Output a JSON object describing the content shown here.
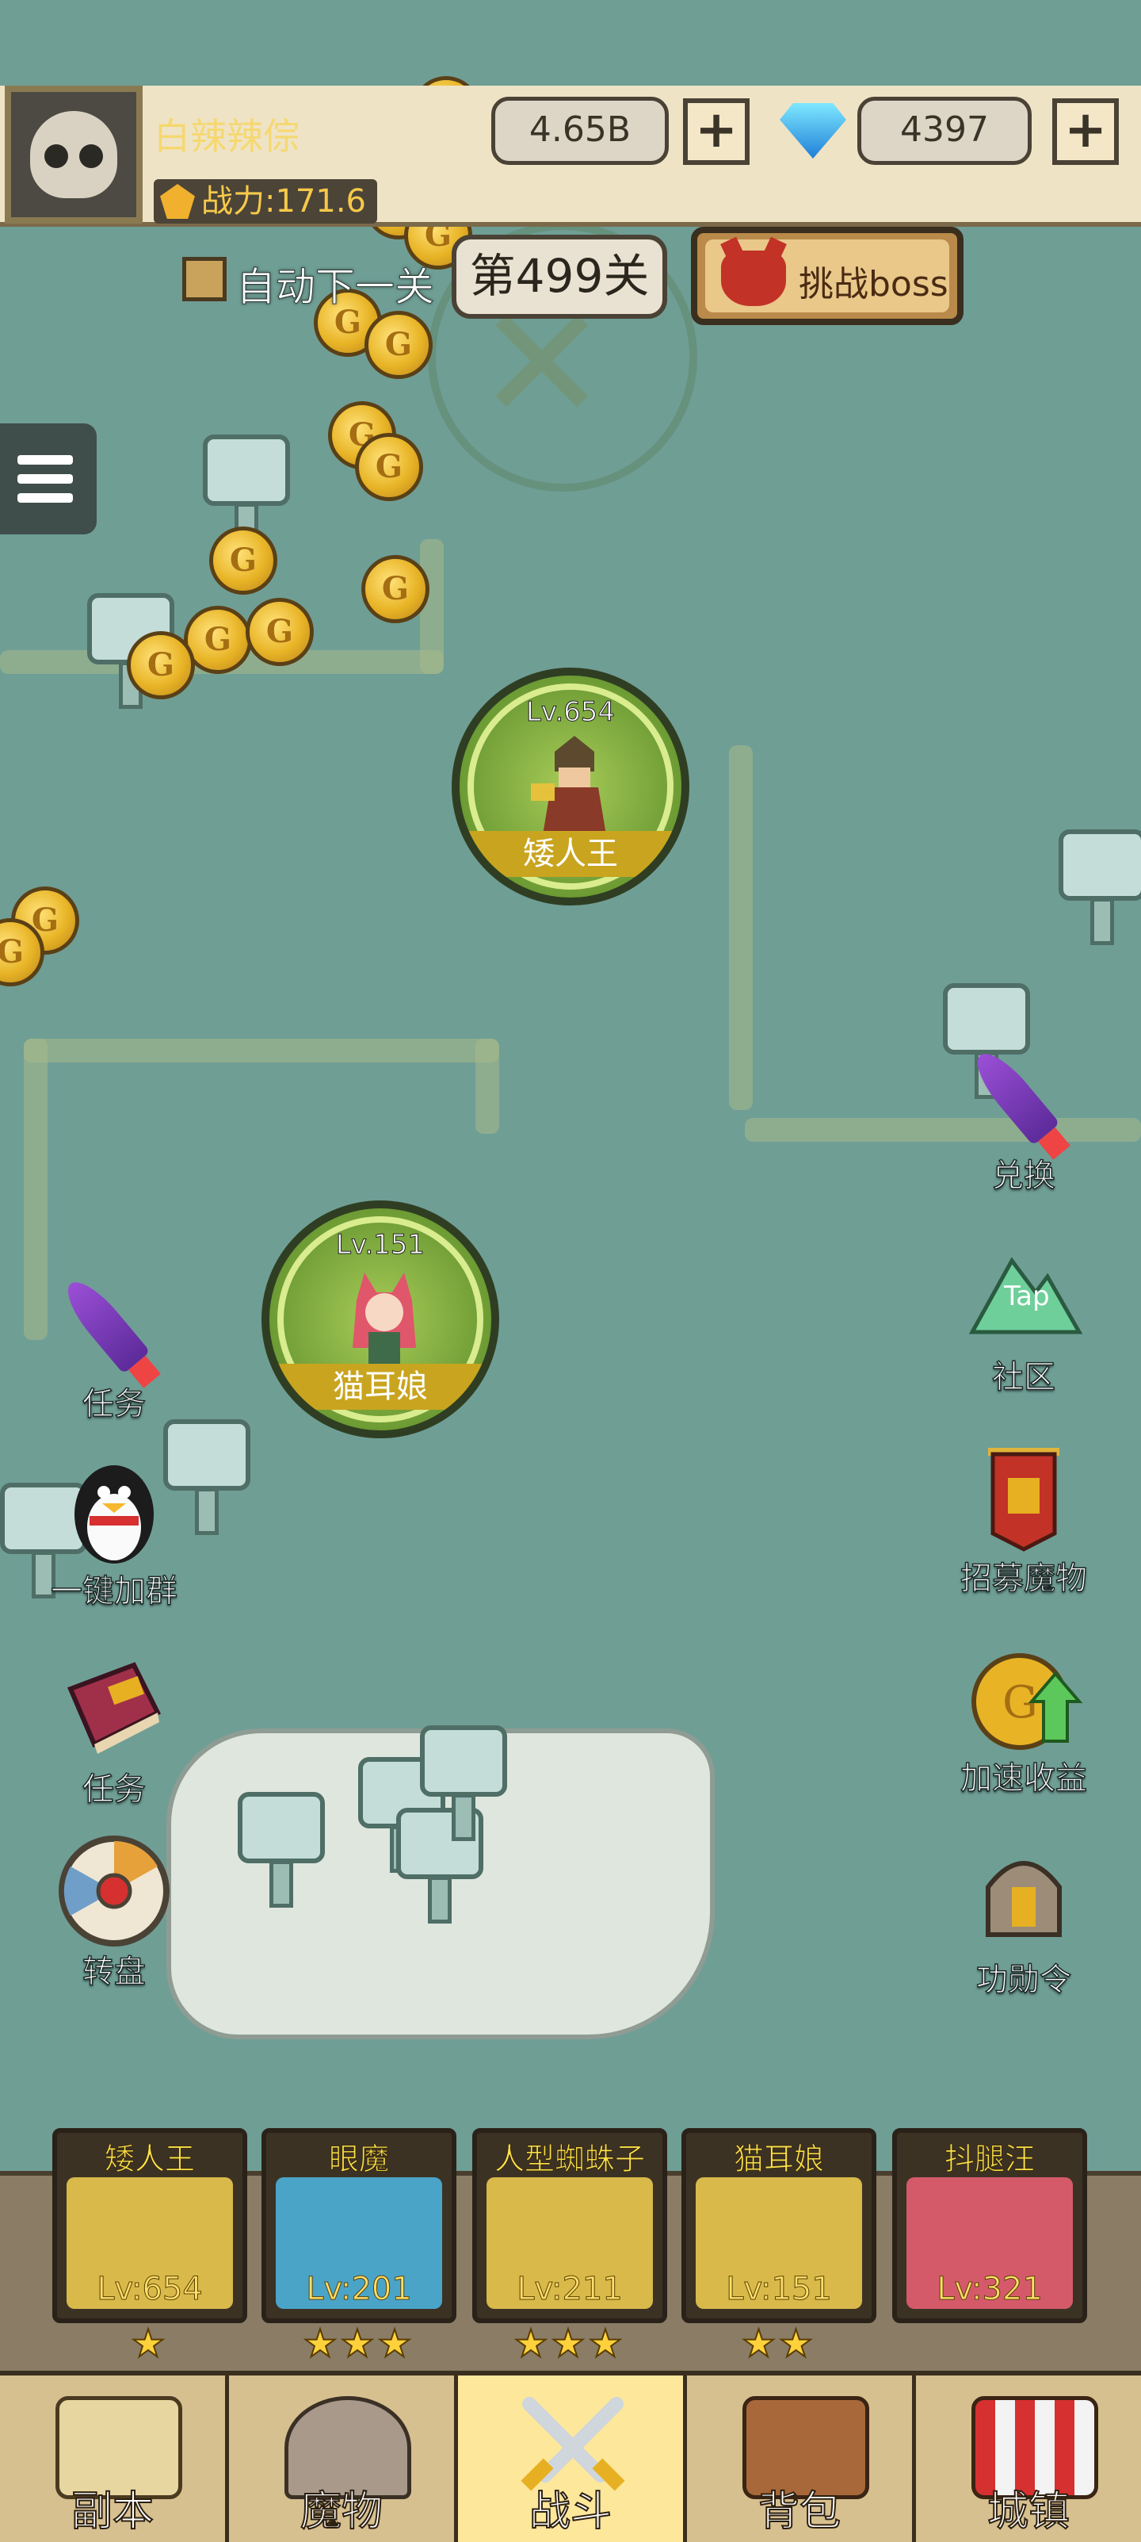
{
  "player": {
    "name": "白辣辣倧",
    "power": "战力:171.6"
  },
  "resources": {
    "gold": "4.65B",
    "gems": "4397"
  },
  "stage": {
    "auto_next_label": "自动下一关",
    "current_stage": "第499关",
    "challenge_boss_label": "挑战boss"
  },
  "map_heroes": [
    {
      "level": "Lv.654",
      "name": "矮人王"
    },
    {
      "level": "Lv.151",
      "name": "猫耳娘"
    }
  ],
  "left_buttons": [
    {
      "label": "任务",
      "icon": "rocket-icon"
    },
    {
      "label": "一键加群",
      "icon": "penguin-icon"
    },
    {
      "label": "任务",
      "icon": "book-icon"
    },
    {
      "label": "转盘",
      "icon": "wheel-icon"
    }
  ],
  "right_buttons": [
    {
      "label": "兑换",
      "icon": "rocket-icon"
    },
    {
      "label": "社区",
      "icon": "tap-mountain-icon",
      "badge": "Tap"
    },
    {
      "label": "招募魔物",
      "icon": "banner-helmet-icon"
    },
    {
      "label": "加速收益",
      "icon": "coin-arrow-icon"
    },
    {
      "label": "功勋令",
      "icon": "helmet-icon"
    }
  ],
  "team": [
    {
      "name": "矮人王",
      "level": "Lv:654",
      "stars": "★",
      "color": "#d8b94a"
    },
    {
      "name": "眼魔",
      "level": "Lv:201",
      "stars": "★★★",
      "color": "#4aa4c8"
    },
    {
      "name": "人型蜘蛛子",
      "level": "Lv:211",
      "stars": "★★★",
      "color": "#d8b94a"
    },
    {
      "name": "猫耳娘",
      "level": "Lv:151",
      "stars": "★★",
      "color": "#d8b94a"
    },
    {
      "name": "抖腿汪",
      "level": "Lv:321",
      "stars": "",
      "color": "#d45a6a"
    }
  ],
  "tabs": [
    {
      "label": "副本",
      "icon": "map-icon"
    },
    {
      "label": "魔物",
      "icon": "monster-helmet-icon"
    },
    {
      "label": "战斗",
      "icon": "crossed-swords-icon"
    },
    {
      "label": "背包",
      "icon": "backpack-icon"
    },
    {
      "label": "城镇",
      "icon": "shop-icon"
    }
  ],
  "colors": {
    "map": "#6f9e95",
    "gold_text": "#f5d870",
    "active_tab": "#fde79a"
  }
}
